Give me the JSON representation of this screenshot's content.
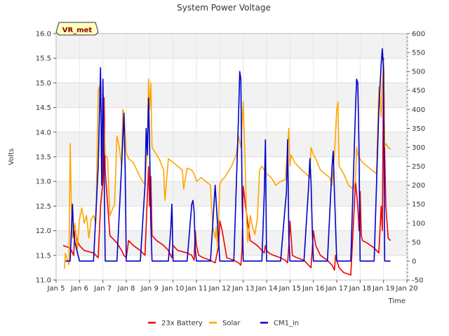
{
  "chart_data": {
    "type": "line",
    "title": "System Power Voltage",
    "xlabel": "Time",
    "ylabel": "Volts",
    "badge": "VR_met",
    "x_ticks": [
      "Jan 5",
      "Jan 6",
      "Jan 7",
      "Jan 8",
      "Jan 9",
      "Jan 10",
      "Jan 11",
      "Jan 12",
      "Jan 13",
      "Jan 14",
      "Jan 15",
      "Jan 16",
      "Jan 17",
      "Jan 18",
      "Jan 19",
      "Jan 20"
    ],
    "xlim": [
      5,
      20
    ],
    "ylim": [
      11.0,
      16.0
    ],
    "y_ticks": [
      "11.0",
      "11.5",
      "12.0",
      "12.5",
      "13.0",
      "13.5",
      "14.0",
      "14.5",
      "15.0",
      "15.5",
      "16.0"
    ],
    "y2lim": [
      -50,
      600
    ],
    "y2_ticks": [
      "-50",
      "0",
      "50",
      "100",
      "150",
      "200",
      "250",
      "300",
      "350",
      "400",
      "450",
      "500",
      "550",
      "600"
    ],
    "grid": true,
    "legend_position": "bottom",
    "colors": {
      "23x Battery": "#ee0000",
      "Solar": "#ffa500",
      "CM1_in": "#0000cc"
    },
    "series": [
      {
        "name": "23x Battery",
        "axis": "left",
        "x": [
          5.3,
          5.6,
          5.75,
          5.8,
          5.9,
          6.0,
          6.2,
          6.6,
          6.8,
          6.9,
          7.0,
          7.05,
          7.1,
          7.3,
          7.6,
          7.8,
          7.9,
          8.0,
          8.1,
          8.3,
          8.6,
          8.8,
          8.95,
          9.0,
          9.05,
          9.1,
          9.3,
          9.6,
          9.8,
          9.9,
          9.95,
          10.0,
          10.2,
          10.6,
          10.8,
          10.9,
          10.95,
          11.0,
          11.1,
          11.3,
          11.6,
          11.8,
          11.95,
          12.0,
          12.1,
          12.3,
          12.6,
          12.8,
          12.9,
          12.95,
          13.0,
          13.1,
          13.3,
          13.6,
          13.8,
          13.9,
          13.95,
          14.0,
          14.1,
          14.3,
          14.6,
          14.8,
          14.9,
          14.95,
          15.0,
          15.1,
          15.3,
          15.6,
          15.8,
          15.9,
          15.95,
          16.0,
          16.1,
          16.3,
          16.6,
          16.8,
          16.9,
          16.95,
          17.0,
          17.1,
          17.3,
          17.6,
          17.7,
          17.8,
          17.9,
          17.95,
          18.0,
          18.05,
          18.1,
          18.3,
          18.6,
          18.8,
          18.9,
          18.95,
          19.0,
          19.05,
          19.1,
          19.2,
          19.3
        ],
        "y": [
          11.7,
          11.65,
          11.5,
          12.0,
          11.8,
          11.7,
          11.6,
          11.55,
          11.45,
          12.5,
          13.0,
          14.7,
          13.2,
          11.9,
          11.75,
          11.6,
          11.5,
          11.45,
          11.8,
          11.7,
          11.6,
          11.5,
          13.3,
          12.5,
          13.1,
          11.9,
          11.8,
          11.7,
          11.6,
          11.5,
          11.45,
          11.7,
          11.6,
          11.55,
          11.5,
          11.4,
          12.0,
          11.7,
          11.5,
          11.45,
          11.4,
          11.35,
          11.7,
          12.2,
          12.0,
          11.45,
          11.4,
          11.35,
          11.3,
          11.6,
          12.9,
          12.5,
          11.8,
          11.7,
          11.6,
          11.55,
          11.7,
          11.6,
          11.55,
          11.5,
          11.45,
          11.4,
          11.35,
          11.7,
          12.2,
          11.5,
          11.45,
          11.4,
          11.3,
          11.25,
          11.6,
          12.0,
          11.7,
          11.5,
          11.4,
          11.3,
          11.2,
          11.5,
          11.4,
          11.25,
          11.15,
          11.1,
          12.0,
          13.0,
          12.5,
          12.0,
          12.8,
          11.9,
          11.8,
          11.75,
          11.65,
          11.55,
          12.5,
          12.0,
          15.5,
          13.6,
          12.5,
          11.85,
          11.8
        ]
      },
      {
        "name": "Solar",
        "axis": "right",
        "x": [
          5.35,
          5.4,
          5.5,
          5.55,
          5.6,
          5.65,
          5.7,
          5.8,
          5.9,
          6.0,
          6.1,
          6.2,
          6.3,
          6.4,
          6.5,
          6.6,
          6.7,
          6.8,
          6.85,
          6.9,
          7.0,
          7.05,
          7.1,
          7.2,
          7.3,
          7.5,
          7.6,
          7.7,
          7.8,
          7.85,
          7.9,
          8.0,
          8.1,
          8.3,
          8.6,
          8.8,
          8.9,
          8.95,
          9.0,
          9.05,
          9.1,
          9.2,
          9.4,
          9.6,
          9.65,
          9.8,
          10.0,
          10.2,
          10.4,
          10.45,
          10.6,
          10.8,
          10.9,
          11.0,
          11.2,
          11.4,
          11.5,
          11.6,
          11.7,
          11.8,
          11.85,
          11.9,
          12.0,
          12.05,
          12.1,
          12.2,
          12.3,
          12.5,
          12.7,
          12.8,
          12.9,
          13.0,
          13.1,
          13.15,
          13.2,
          13.3,
          13.4,
          13.5,
          13.6,
          13.7,
          13.8,
          13.9,
          14.0,
          14.2,
          14.4,
          14.6,
          14.8,
          14.95,
          15.0,
          15.05,
          15.2,
          15.5,
          15.7,
          15.85,
          15.9,
          16.0,
          16.1,
          16.3,
          16.5,
          16.7,
          16.8,
          16.9,
          17.0,
          17.05,
          17.1,
          17.3,
          17.5,
          17.7,
          17.8,
          17.85,
          17.9,
          18.0,
          18.1,
          18.3,
          18.5,
          18.7,
          18.8,
          18.9,
          18.95,
          19.0,
          19.05,
          19.1,
          19.2,
          19.3
        ],
        "y": [
          -20,
          20,
          0,
          -10,
          310,
          150,
          60,
          100,
          30,
          110,
          140,
          100,
          120,
          60,
          110,
          120,
          100,
          450,
          460,
          400,
          390,
          350,
          280,
          270,
          120,
          150,
          330,
          300,
          250,
          400,
          390,
          285,
          270,
          260,
          220,
          200,
          300,
          480,
          400,
          470,
          300,
          290,
          270,
          240,
          160,
          270,
          260,
          250,
          240,
          190,
          245,
          240,
          230,
          210,
          220,
          210,
          205,
          200,
          90,
          60,
          90,
          40,
          200,
          210,
          215,
          220,
          230,
          250,
          280,
          330,
          300,
          420,
          220,
          100,
          50,
          120,
          90,
          70,
          110,
          240,
          250,
          240,
          230,
          220,
          200,
          210,
          215,
          350,
          250,
          280,
          260,
          240,
          230,
          220,
          300,
          280,
          270,
          240,
          230,
          220,
          200,
          280,
          400,
          420,
          250,
          230,
          200,
          190,
          210,
          300,
          280,
          270,
          260,
          250,
          240,
          230,
          460,
          380,
          480,
          530,
          300,
          310,
          300,
          295
        ]
      },
      {
        "name": "CM1_in",
        "axis": "right",
        "x": [
          5.4,
          5.6,
          5.7,
          5.75,
          5.8,
          6.0,
          6.6,
          6.8,
          6.9,
          6.95,
          7.0,
          7.1,
          7.2,
          7.6,
          7.8,
          7.9,
          7.95,
          8.0,
          8.1,
          8.6,
          8.8,
          8.85,
          8.9,
          8.95,
          9.0,
          9.05,
          9.1,
          9.2,
          9.8,
          9.9,
          9.95,
          10.0,
          10.6,
          10.8,
          10.85,
          10.9,
          10.95,
          11.0,
          11.1,
          11.6,
          11.8,
          11.85,
          11.9,
          11.95,
          12.0,
          12.1,
          12.6,
          12.8,
          12.85,
          12.9,
          12.95,
          13.0,
          13.1,
          13.2,
          13.8,
          13.9,
          13.95,
          14.0,
          14.6,
          14.8,
          14.85,
          14.9,
          14.95,
          15.0,
          15.1,
          15.6,
          15.8,
          15.85,
          15.9,
          15.95,
          16.0,
          16.6,
          16.8,
          16.85,
          16.9,
          17.0,
          17.1,
          17.6,
          17.8,
          17.85,
          17.9,
          17.95,
          18.0,
          18.05,
          18.1,
          18.6,
          18.8,
          18.9,
          18.95,
          19.0,
          19.05,
          19.1,
          19.2,
          19.3
        ],
        "y": [
          0,
          0,
          150,
          70,
          50,
          0,
          0,
          250,
          510,
          200,
          480,
          0,
          0,
          0,
          250,
          390,
          250,
          0,
          0,
          0,
          200,
          350,
          280,
          430,
          300,
          100,
          0,
          0,
          0,
          80,
          150,
          0,
          0,
          150,
          160,
          130,
          30,
          0,
          0,
          0,
          200,
          150,
          100,
          50,
          0,
          0,
          0,
          380,
          500,
          480,
          180,
          0,
          0,
          0,
          0,
          180,
          320,
          0,
          0,
          150,
          180,
          320,
          60,
          0,
          0,
          0,
          200,
          270,
          210,
          90,
          0,
          0,
          250,
          290,
          180,
          0,
          0,
          0,
          400,
          480,
          470,
          300,
          0,
          0,
          0,
          0,
          400,
          520,
          560,
          500,
          0,
          0,
          0,
          0
        ]
      }
    ]
  }
}
